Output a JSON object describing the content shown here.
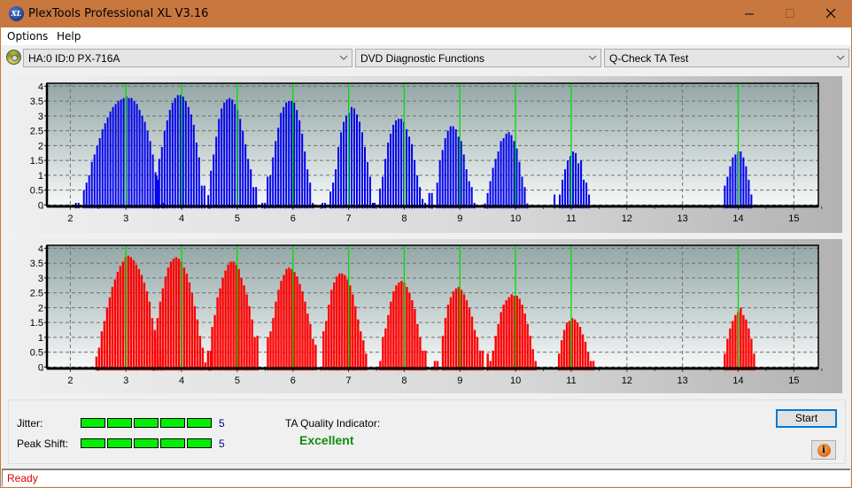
{
  "window": {
    "title": "PlexTools Professional XL V3.16",
    "app_icon_text": "XL",
    "controls": {
      "minimize": "minimize-icon",
      "maximize": "maximize-icon",
      "close": "close-icon"
    }
  },
  "menu": {
    "items": [
      {
        "label": "Options"
      },
      {
        "label": "Help"
      }
    ]
  },
  "toolbar": {
    "drive": {
      "value": "HA:0 ID:0  PX-716A",
      "icon": "disc-drive-icon"
    },
    "function": {
      "value": "DVD Diagnostic Functions"
    },
    "test": {
      "value": "Q-Check TA Test"
    }
  },
  "colors": {
    "titlebar": "#c8773f",
    "top_bars": "#0000ee",
    "bottom_bars": "#ff0000",
    "marker_lines": "#00e000",
    "meter_on": "#00f000",
    "quality_text": "#118b11",
    "status_text": "#e00000"
  },
  "results": {
    "jitter_label": "Jitter:",
    "jitter_value": "5",
    "jitter_level": 5,
    "jitter_max": 5,
    "peak_shift_label": "Peak Shift:",
    "peak_shift_value": "5",
    "peak_shift_level": 5,
    "peak_shift_max": 5,
    "ta_quality_label": "TA Quality Indicator:",
    "ta_quality_value": "Excellent"
  },
  "buttons": {
    "start": "Start",
    "info_icon": "info-icon"
  },
  "status": {
    "text": "Ready"
  },
  "chart_data": [
    {
      "type": "bar",
      "name": "ta-histogram-top",
      "xlabel": "",
      "ylabel": "",
      "xlim": [
        1.58,
        15.44
      ],
      "ylim": [
        -0.05,
        4.1
      ],
      "xticks": [
        2,
        3,
        4,
        5,
        6,
        7,
        8,
        9,
        10,
        11,
        12,
        13,
        14,
        15
      ],
      "yticks": [
        0,
        0.5,
        1,
        1.5,
        2,
        2.5,
        3,
        3.5,
        4
      ],
      "ytick_labels": [
        "0",
        "0.5",
        "1",
        "1.5",
        "2",
        "2.5",
        "3",
        "3.5",
        "4"
      ],
      "grid": true,
      "marker_lines": [
        3,
        4,
        5,
        6,
        7,
        8,
        9,
        10,
        11,
        14
      ],
      "bin_width": 0.0477,
      "clusters": [
        {
          "start": 2.1,
          "values": [
            0.07,
            0.07,
            0,
            0.5,
            0.75,
            1.0,
            1.45,
            1.7,
            2.0,
            2.25,
            2.55,
            2.75,
            2.95,
            3.15,
            3.3,
            3.4,
            3.5,
            3.55,
            3.6,
            3.65,
            3.6,
            3.6,
            3.5,
            3.4,
            3.2,
            3.0,
            2.8,
            2.5,
            2.15,
            1.7,
            1.1,
            0.85,
            0,
            0.07
          ]
        },
        {
          "start": 3.55,
          "values": [
            1.0,
            1.55,
            1.95,
            2.5,
            2.85,
            3.2,
            3.45,
            3.6,
            3.7,
            3.7,
            3.65,
            3.5,
            3.3,
            3.05,
            2.7,
            2.1,
            1.6,
            0.65,
            0.65
          ]
        },
        {
          "start": 4.48,
          "values": [
            0.33,
            1.15,
            1.7,
            2.3,
            2.9,
            3.25,
            3.45,
            3.55,
            3.6,
            3.55,
            3.4,
            3.2,
            2.9,
            2.5,
            2.05,
            1.55,
            1.2,
            0.6,
            0.6
          ]
        },
        {
          "start": 5.45,
          "values": [
            0.07,
            0.07,
            0.95,
            1.0,
            1.6,
            2.15,
            2.6,
            3.1,
            3.3,
            3.45,
            3.5,
            3.5,
            3.45,
            3.2,
            2.85,
            2.4,
            1.8,
            1.2,
            0.75,
            0.07
          ]
        },
        {
          "start": 6.53,
          "values": [
            0.07,
            0.07,
            0.0,
            0.45,
            0.75,
            1.2,
            1.95,
            2.45,
            2.8,
            3.0,
            3.1,
            3.3,
            3.25,
            3.05,
            2.8,
            2.45,
            1.95,
            1.45,
            0.95,
            0.07
          ]
        },
        {
          "start": 7.47,
          "values": [
            0.07,
            0.0,
            0.55,
            0.95,
            1.55,
            2.1,
            2.4,
            2.7,
            2.85,
            2.9,
            2.9,
            2.8,
            2.55,
            2.3,
            2.05,
            1.5,
            1.0,
            0.6,
            0.2,
            0.07
          ]
        },
        {
          "start": 8.45,
          "values": [
            0.4,
            0.4,
            0.0,
            0.75,
            1.5,
            1.85,
            2.25,
            2.5,
            2.65,
            2.65,
            2.55,
            2.3,
            2.15,
            1.7,
            1.2,
            0.8,
            0.6,
            0.07
          ]
        },
        {
          "start": 9.45,
          "values": [
            0.05,
            0.4,
            0.8,
            1.25,
            1.55,
            1.8,
            2.15,
            2.25,
            2.4,
            2.45,
            2.35,
            2.15,
            1.9,
            1.45,
            0.95,
            0.6,
            0.05
          ]
        },
        {
          "start": 10.7,
          "values": [
            0.35,
            0.0,
            0.35,
            0.85,
            1.2,
            1.5,
            1.65,
            1.8,
            1.75,
            1.4,
            1.5,
            0.85,
            0.75,
            0.35
          ]
        },
        {
          "start": 13.76,
          "values": [
            0.65,
            0.95,
            1.3,
            1.6,
            1.7,
            1.8,
            1.8,
            1.6,
            1.3,
            0.85,
            0.35
          ]
        }
      ]
    },
    {
      "type": "bar",
      "name": "ta-histogram-bottom",
      "xlabel": "",
      "ylabel": "",
      "xlim": [
        1.58,
        15.44
      ],
      "ylim": [
        -0.05,
        4.1
      ],
      "xticks": [
        2,
        3,
        4,
        5,
        6,
        7,
        8,
        9,
        10,
        11,
        12,
        13,
        14,
        15
      ],
      "yticks": [
        0,
        0.5,
        1,
        1.5,
        2,
        2.5,
        3,
        3.5,
        4
      ],
      "ytick_labels": [
        "0",
        "0.5",
        "1",
        "1.5",
        "2",
        "2.5",
        "3",
        "3.5",
        "4"
      ],
      "grid": true,
      "marker_lines": [
        3,
        4,
        5,
        6,
        7,
        8,
        9,
        10,
        11,
        14
      ],
      "bin_width": 0.0477,
      "clusters": [
        {
          "start": 2.47,
          "values": [
            0.35,
            0.65,
            1.2,
            1.55,
            2.0,
            2.35,
            2.7,
            2.95,
            3.2,
            3.4,
            3.55,
            3.7,
            3.75,
            3.7,
            3.6,
            3.45,
            3.3,
            3.1,
            2.85,
            2.55,
            2.2,
            1.65,
            1.25,
            0.95,
            0.35,
            0.6
          ]
        },
        {
          "start": 3.52,
          "values": [
            1.2,
            1.65,
            2.2,
            2.65,
            3.05,
            3.35,
            3.55,
            3.65,
            3.7,
            3.65,
            3.55,
            3.35,
            3.15,
            2.85,
            2.5,
            2.05,
            1.6,
            1.05,
            0.65,
            0.15,
            0.55,
            0.55
          ]
        },
        {
          "start": 4.55,
          "values": [
            1.35,
            1.75,
            2.35,
            2.65,
            3.0,
            3.25,
            3.45,
            3.55,
            3.55,
            3.45,
            3.3,
            3.0,
            2.75,
            2.45,
            2.05,
            1.6,
            1.0,
            1.05
          ]
        },
        {
          "start": 5.55,
          "values": [
            1.0,
            1.2,
            1.65,
            2.2,
            2.6,
            2.9,
            3.1,
            3.3,
            3.35,
            3.3,
            3.2,
            3.05,
            2.8,
            2.55,
            2.2,
            1.8,
            1.45,
            0.95,
            0.75
          ]
        },
        {
          "start": 6.55,
          "values": [
            1.2,
            1.55,
            2.1,
            2.6,
            2.85,
            3.05,
            3.15,
            3.15,
            3.1,
            2.95,
            2.75,
            2.45,
            2.05,
            1.6,
            1.2,
            0.9,
            0.45
          ]
        },
        {
          "start": 7.57,
          "values": [
            0.2,
            1.0,
            1.3,
            1.75,
            2.2,
            2.55,
            2.75,
            2.85,
            2.9,
            2.85,
            2.7,
            2.5,
            2.25,
            1.95,
            1.45,
            1.0,
            0.55,
            0.55
          ]
        },
        {
          "start": 8.55,
          "values": [
            0.2,
            0.2,
            0.0,
            1.05,
            1.65,
            2.1,
            2.35,
            2.55,
            2.65,
            2.7,
            2.6,
            2.45,
            2.25,
            2.0,
            1.7,
            1.25,
            1.0,
            0.55,
            0.55
          ]
        },
        {
          "start": 9.5,
          "values": [
            0.45,
            0.2,
            0.55,
            1.05,
            1.45,
            1.85,
            2.1,
            2.25,
            2.35,
            2.45,
            2.4,
            2.4,
            2.3,
            2.1,
            1.8,
            1.45,
            1.05,
            0.6,
            0.2
          ]
        },
        {
          "start": 10.78,
          "values": [
            0.45,
            0.9,
            1.25,
            1.5,
            1.55,
            1.65,
            1.6,
            1.5,
            1.35,
            1.1,
            0.85,
            0.5,
            0.2,
            0.2
          ]
        },
        {
          "start": 13.76,
          "values": [
            0.45,
            0.95,
            1.3,
            1.55,
            1.75,
            1.85,
            2.0,
            1.75,
            1.6,
            1.3,
            0.95,
            0.45
          ]
        }
      ]
    }
  ]
}
